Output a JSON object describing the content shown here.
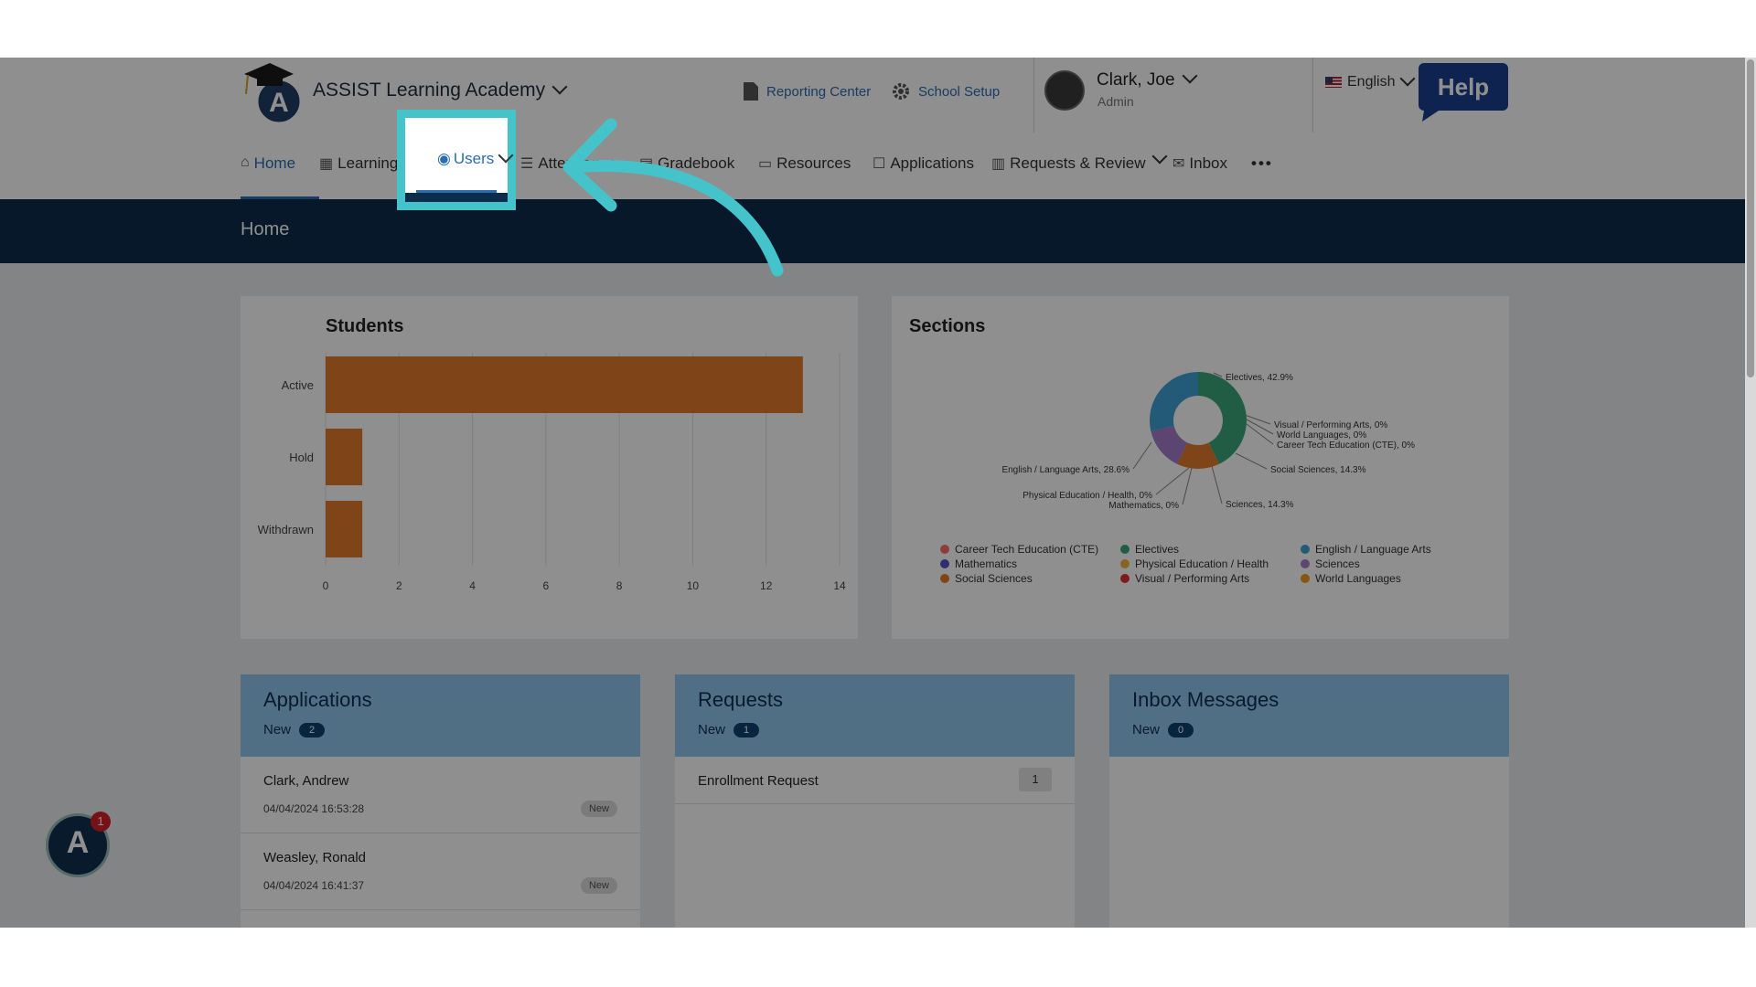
{
  "header": {
    "school_name": "ASSIST Learning Academy",
    "reporting_center": "Reporting Center",
    "school_setup": "School Setup",
    "user_name": "Clark, Joe",
    "user_role": "Admin",
    "language": "English",
    "help_label": "Help"
  },
  "nav": {
    "items": [
      {
        "label": "Home",
        "icon": "home-icon",
        "active": true
      },
      {
        "label": "Learning",
        "icon": "grid-icon",
        "dropdown": true
      },
      {
        "label": "Users",
        "icon": "user-circle-icon",
        "dropdown": true
      },
      {
        "label": "Attendance",
        "icon": "list-icon"
      },
      {
        "label": "Gradebook",
        "icon": "book-icon"
      },
      {
        "label": "Resources",
        "icon": "monitor-icon"
      },
      {
        "label": "Applications",
        "icon": "chat-icon"
      },
      {
        "label": "Requests & Review",
        "icon": "document-icon",
        "dropdown": true
      },
      {
        "label": "Inbox",
        "icon": "envelope-icon"
      }
    ],
    "more": "•••"
  },
  "banner": {
    "title": "Home"
  },
  "students": {
    "title": "Students",
    "chart_data": {
      "type": "bar",
      "orientation": "horizontal",
      "categories": [
        "Active",
        "Hold",
        "Withdrawn"
      ],
      "values": [
        13,
        1,
        1
      ],
      "xlim": [
        0,
        14
      ],
      "xticks": [
        "0",
        "2",
        "4",
        "6",
        "8",
        "10",
        "12",
        "14"
      ],
      "grid": true,
      "bar_color": "#e37c2e"
    }
  },
  "sections": {
    "title": "Sections",
    "chart_data": {
      "type": "pie",
      "donut": true,
      "slices": [
        {
          "name": "Career Tech Education (CTE)",
          "value": 0,
          "label": "Career Tech Education (CTE), 0%",
          "color": "#ff6b6b"
        },
        {
          "name": "Electives",
          "value": 42.9,
          "label": "Electives, 42.9%",
          "color": "#3aa67a"
        },
        {
          "name": "English / Language Arts",
          "value": 28.6,
          "label": "English / Language Arts, 28.6%",
          "color": "#3fa1d6"
        },
        {
          "name": "Mathematics",
          "value": 0,
          "label": "Mathematics, 0%",
          "color": "#5254c4"
        },
        {
          "name": "Physical Education / Health",
          "value": 0,
          "label": "Physical Education / Health, 0%",
          "color": "#f0b23e"
        },
        {
          "name": "Sciences",
          "value": 14.3,
          "label": "Sciences, 14.3%",
          "color": "#a77cc9"
        },
        {
          "name": "Social Sciences",
          "value": 14.3,
          "label": "Social Sciences, 14.3%",
          "color": "#e37c2e"
        },
        {
          "name": "Visual / Performing Arts",
          "value": 0,
          "label": "Visual / Performing Arts, 0%",
          "color": "#e2302b"
        },
        {
          "name": "World Languages",
          "value": 0,
          "label": "World Languages, 0%",
          "color": "#f09a1e"
        }
      ],
      "legend_placement": "bottom"
    }
  },
  "applications": {
    "title": "Applications",
    "new_label": "New",
    "new_count": "2",
    "items": [
      {
        "name": "Clark, Andrew",
        "date": "04/04/2024 16:53:28",
        "status": "New"
      },
      {
        "name": "Weasley, Ronald",
        "date": "04/04/2024 16:41:37",
        "status": "New"
      }
    ]
  },
  "requests": {
    "title": "Requests",
    "new_label": "New",
    "new_count": "1",
    "items": [
      {
        "name": "Enrollment Request",
        "count": "1"
      }
    ]
  },
  "inbox": {
    "title": "Inbox Messages",
    "new_label": "New",
    "new_count": "0"
  },
  "chat_widget": {
    "letter": "A",
    "badge": "1"
  }
}
